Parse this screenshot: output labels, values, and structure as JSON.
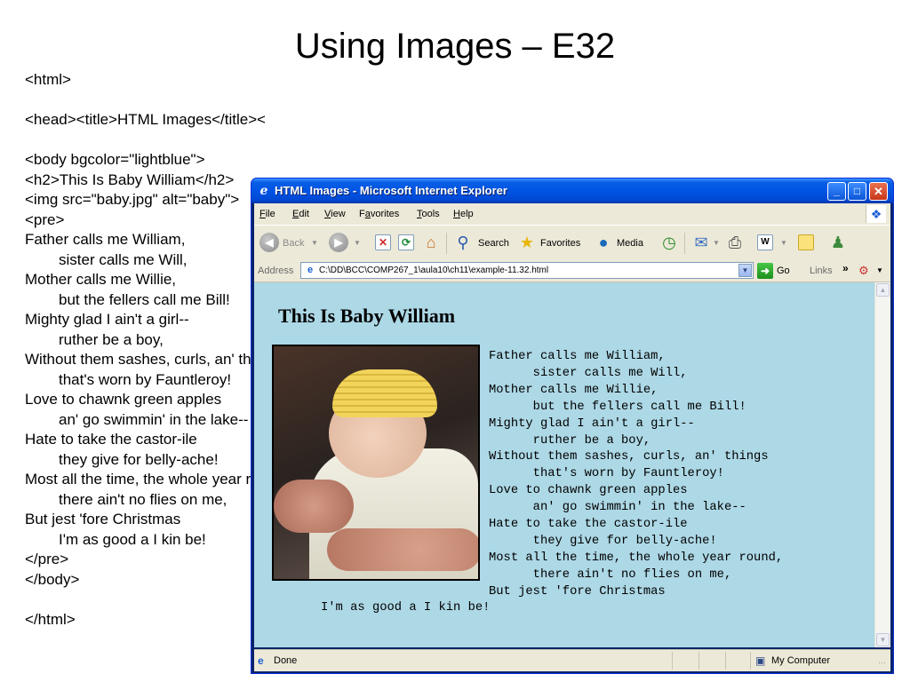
{
  "slide": {
    "title": "Using Images – E32",
    "code_lines": [
      {
        "text": "<html>",
        "indent": false
      },
      {
        "text": "",
        "indent": false
      },
      {
        "text": "<head><title>HTML Images</title></head>",
        "indent": false
      },
      {
        "text": "",
        "indent": false
      },
      {
        "text": "<body bgcolor=\"lightblue\">",
        "indent": false
      },
      {
        "text": "<h2>This Is Baby William</h2>",
        "indent": false
      },
      {
        "text": "<img src=\"baby.jpg\" alt=\"baby\">",
        "indent": false
      },
      {
        "text": "<pre>",
        "indent": false
      },
      {
        "text": "Father calls me William,",
        "indent": false
      },
      {
        "text": "sister calls me Will,",
        "indent": true
      },
      {
        "text": "Mother calls me Willie,",
        "indent": false
      },
      {
        "text": "but the fellers call me Bill!",
        "indent": true
      },
      {
        "text": "Mighty glad I ain't a girl--",
        "indent": false
      },
      {
        "text": "ruther be a boy,",
        "indent": true
      },
      {
        "text": "Without them sashes, curls, an' things",
        "indent": false
      },
      {
        "text": "that's worn by Fauntleroy!",
        "indent": true
      },
      {
        "text": "Love to chawnk green apples",
        "indent": false
      },
      {
        "text": "an' go swimmin' in the lake--",
        "indent": true
      },
      {
        "text": "Hate to take the castor-ile",
        "indent": false
      },
      {
        "text": "they give for belly-ache!",
        "indent": true
      },
      {
        "text": "Most all the time, the whole year round,",
        "indent": false
      },
      {
        "text": "there ain't no flies on me,",
        "indent": true
      },
      {
        "text": "But jest 'fore Christmas",
        "indent": false
      },
      {
        "text": "I'm as good a I kin be!",
        "indent": true
      },
      {
        "text": "</pre>",
        "indent": false
      },
      {
        "text": "</body>",
        "indent": false
      },
      {
        "text": "",
        "indent": false
      },
      {
        "text": "</html>",
        "indent": false
      }
    ]
  },
  "browser": {
    "window_title": "HTML Images - Microsoft Internet Explorer",
    "title_icon": "ie-icon",
    "window_buttons": {
      "minimize": "_",
      "maximize": "□",
      "close": "✕"
    },
    "menu": [
      {
        "label": "File",
        "key": "F",
        "rest": "ile"
      },
      {
        "label": "Edit",
        "key": "E",
        "rest": "dit"
      },
      {
        "label": "View",
        "key": "V",
        "rest": "iew"
      },
      {
        "label": "Favorites",
        "key": "a",
        "pre": "F",
        "rest": "vorites"
      },
      {
        "label": "Tools",
        "key": "T",
        "rest": "ools"
      },
      {
        "label": "Help",
        "key": "H",
        "rest": "elp"
      }
    ],
    "toolbar": {
      "back": "Back",
      "search": "Search",
      "favorites": "Favorites",
      "media": "Media"
    },
    "address": {
      "label": "Address",
      "value": "C:\\DD\\BCC\\COMP267_1\\aula10\\ch11\\example-11.32.html",
      "go": "Go",
      "links": "Links"
    },
    "status": {
      "text": "Done",
      "zone": "My Computer"
    },
    "accent": "#0054e3",
    "content_bg": "#add8e6"
  },
  "page": {
    "heading": "This Is Baby William",
    "image_alt": "baby",
    "poem": "Father calls me William,\n      sister calls me Will,\nMother calls me Willie,\n      but the fellers call me Bill!\nMighty glad I ain't a girl--\n      ruther be a boy,\nWithout them sashes, curls, an' things\n      that's worn by Fauntleroy!\nLove to chawnk green apples\n      an' go swimmin' in the lake--\nHate to take the castor-ile\n      they give for belly-ache!\nMost all the time, the whole year round,\n      there ain't no flies on me,\nBut jest 'fore Christmas",
    "poem_last": "I'm as good a I kin be!"
  }
}
